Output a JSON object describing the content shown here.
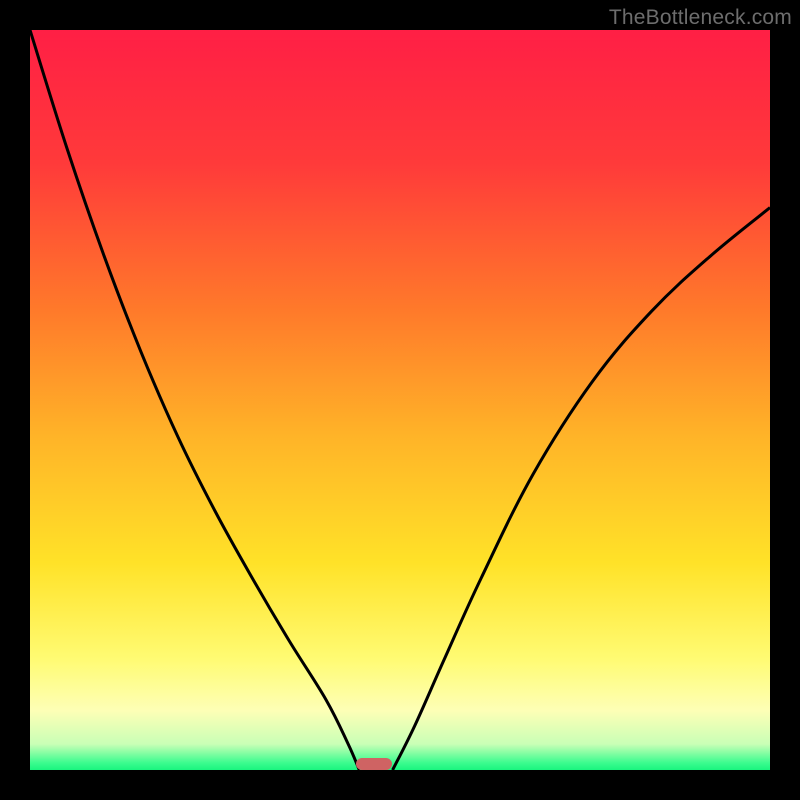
{
  "watermark": "TheBottleneck.com",
  "chart_data": {
    "type": "line",
    "title": "",
    "xlabel": "",
    "ylabel": "",
    "xlim": [
      0,
      1
    ],
    "ylim": [
      0,
      1
    ],
    "gradient_stops": [
      {
        "offset": 0.0,
        "color": "#ff1f45"
      },
      {
        "offset": 0.18,
        "color": "#ff3a3a"
      },
      {
        "offset": 0.38,
        "color": "#ff7a2a"
      },
      {
        "offset": 0.55,
        "color": "#ffb428"
      },
      {
        "offset": 0.72,
        "color": "#ffe228"
      },
      {
        "offset": 0.85,
        "color": "#fffb73"
      },
      {
        "offset": 0.92,
        "color": "#fdffb6"
      },
      {
        "offset": 0.965,
        "color": "#c9ffb6"
      },
      {
        "offset": 0.99,
        "color": "#3dfc8f"
      },
      {
        "offset": 1.0,
        "color": "#1af57f"
      }
    ],
    "series": [
      {
        "name": "left-curve",
        "x": [
          0.0,
          0.05,
          0.1,
          0.15,
          0.2,
          0.25,
          0.3,
          0.35,
          0.4,
          0.43,
          0.445
        ],
        "y": [
          1.0,
          0.84,
          0.695,
          0.565,
          0.45,
          0.35,
          0.26,
          0.175,
          0.095,
          0.035,
          0.0
        ]
      },
      {
        "name": "right-curve",
        "x": [
          0.49,
          0.52,
          0.56,
          0.61,
          0.68,
          0.76,
          0.84,
          0.92,
          1.0
        ],
        "y": [
          0.0,
          0.06,
          0.15,
          0.26,
          0.4,
          0.525,
          0.62,
          0.695,
          0.76
        ]
      }
    ],
    "marker": {
      "x": 0.465,
      "y": 0.008,
      "color": "#cf6363"
    },
    "curve_style": {
      "stroke": "#000000",
      "width": 3
    }
  }
}
